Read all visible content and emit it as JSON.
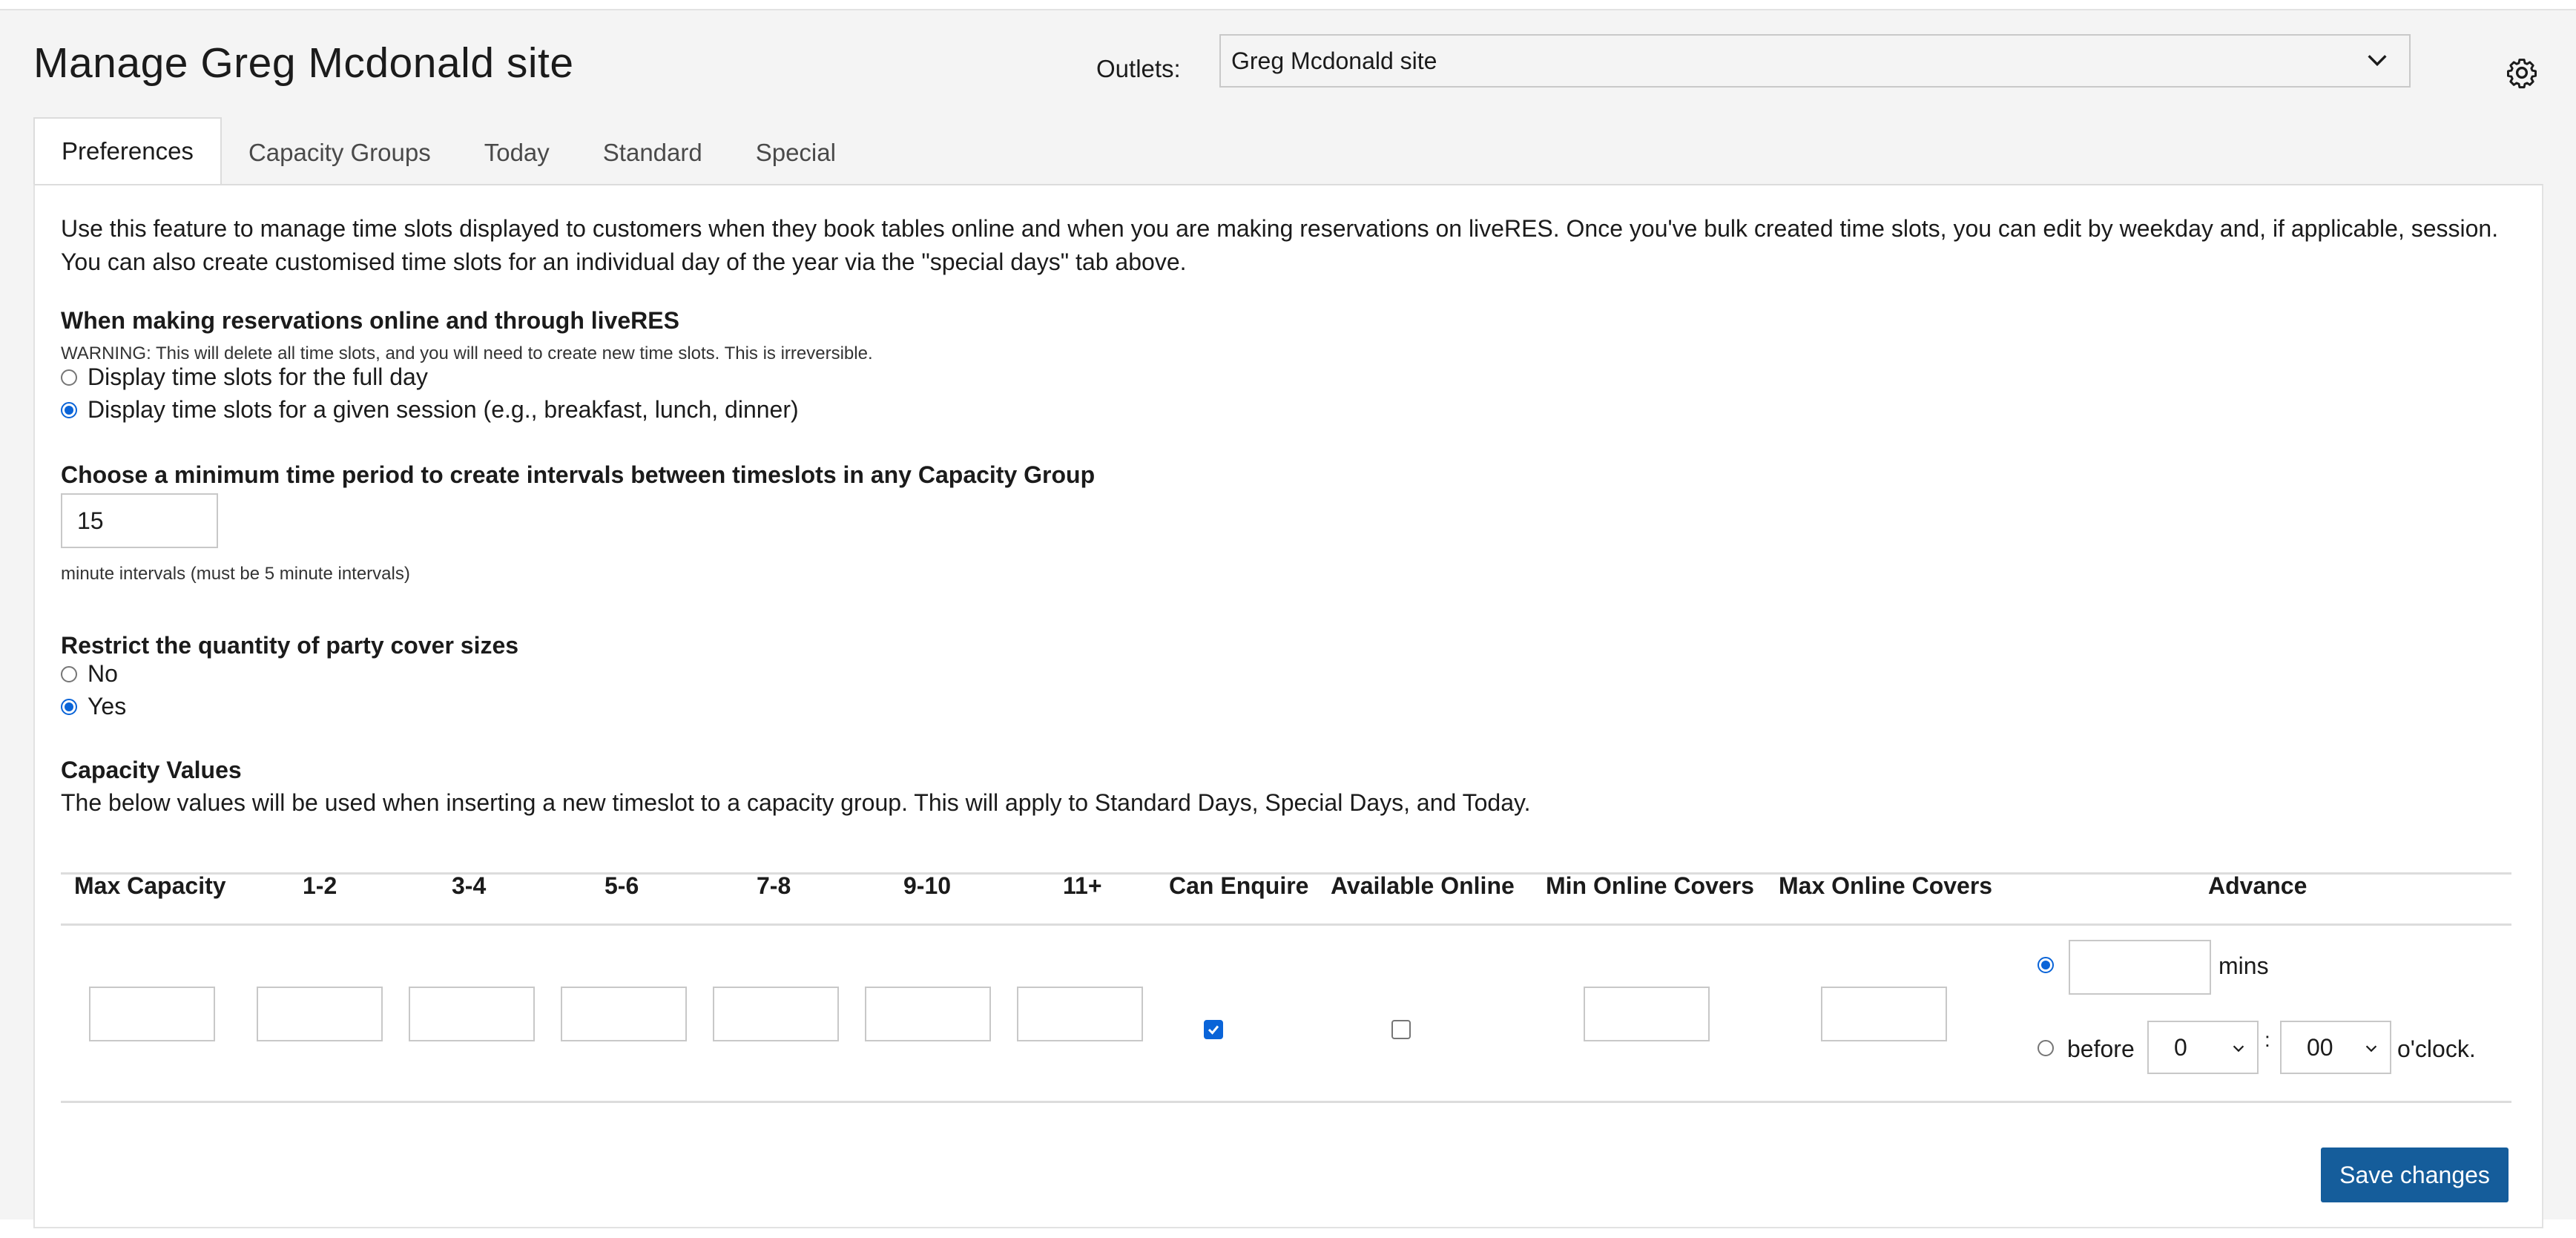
{
  "header": {
    "title": "Manage Greg Mcdonald site",
    "outlets_label": "Outlets:",
    "outlet_selected": "Greg Mcdonald site"
  },
  "tabs": [
    {
      "label": "Preferences",
      "active": true
    },
    {
      "label": "Capacity Groups"
    },
    {
      "label": "Today"
    },
    {
      "label": "Standard"
    },
    {
      "label": "Special"
    }
  ],
  "intro": {
    "line1": "Use this feature to manage time slots displayed to customers when they book tables online and when you are making reservations on liveRES. Once you've bulk created time slots, you can edit by weekday and, if applicable, session.",
    "line2": "You can also create customised time slots for an individual day of the year via the \"special days\" tab above."
  },
  "reservations": {
    "heading": "When making reservations online and through liveRES",
    "warning": "WARNING: This will delete all time slots, and you will need to create new time slots. This is irreversible.",
    "option_full_day": "Display time slots for the full day",
    "option_session": "Display time slots for a given session (e.g., breakfast, lunch, dinner)",
    "selected": "session"
  },
  "interval": {
    "heading": "Choose a minimum time period to create intervals between timeslots in any Capacity Group",
    "value": "15",
    "hint": "minute intervals (must be 5 minute intervals)"
  },
  "party": {
    "heading": "Restrict the quantity of party cover sizes",
    "option_no": "No",
    "option_yes": "Yes",
    "selected": "yes"
  },
  "capacity": {
    "heading": "Capacity Values",
    "description": "The below values will be used when inserting a new timeslot to a capacity group. This will apply to Standard Days, Special Days, and Today.",
    "columns": [
      "Max Capacity",
      "1-2",
      "3-4",
      "5-6",
      "7-8",
      "9-10",
      "11+",
      "Can Enquire",
      "Available Online",
      "Min Online Covers",
      "Max Online Covers",
      "Advance"
    ],
    "can_enquire": true,
    "available_online": false,
    "advance": {
      "mins_label": "mins",
      "before_label": "before",
      "hour": "0",
      "minute": "00",
      "colon": ":",
      "oclock_label": "o'clock.",
      "selected": "mins"
    }
  },
  "actions": {
    "save_label": "Save changes"
  },
  "colors": {
    "accent": "#0a64d8",
    "save_button": "#155d9b"
  }
}
